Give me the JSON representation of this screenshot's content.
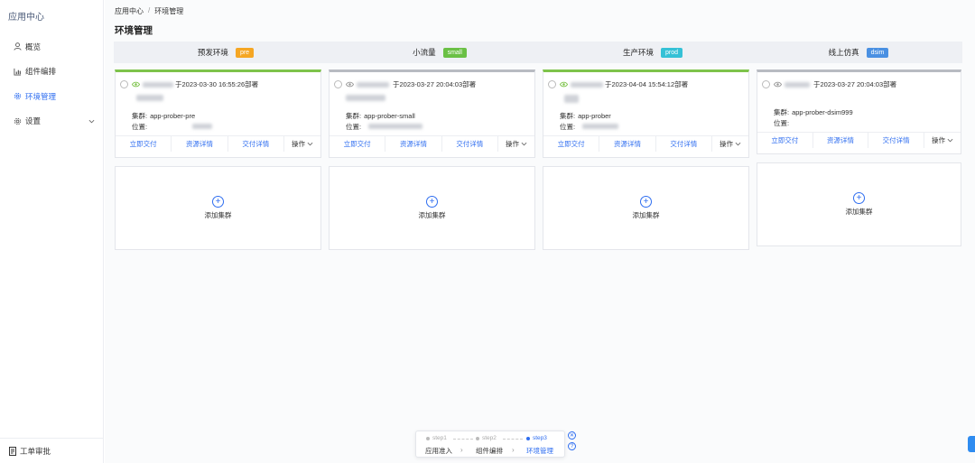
{
  "app": {
    "title": "应用中心"
  },
  "sidebar": {
    "items": [
      {
        "label": "概览",
        "icon": "user-icon"
      },
      {
        "label": "组件编排",
        "icon": "bar-chart-icon"
      },
      {
        "label": "环境管理",
        "icon": "gear-icon",
        "active": true
      },
      {
        "label": "设置",
        "icon": "gear-icon"
      }
    ],
    "footer": {
      "label": "工单审批",
      "icon": "document-icon"
    }
  },
  "breadcrumb": {
    "root": "应用中心",
    "sep": "/",
    "current": "环境管理"
  },
  "page": {
    "title": "环境管理"
  },
  "stages": [
    {
      "name": "预发环境",
      "badge": "pre",
      "badge_color": "#f5a623",
      "bar_color": "#7ec34b"
    },
    {
      "name": "小流量",
      "badge": "small",
      "badge_color": "#6ac045",
      "bar_color": "#b8bbc2"
    },
    {
      "name": "生产环境",
      "badge": "prod",
      "badge_color": "#35c1d6",
      "bar_color": "#7ec34b"
    },
    {
      "name": "线上仿真",
      "badge": "dsim",
      "badge_color": "#4a90e2",
      "bar_color": "#b8bbc2"
    }
  ],
  "cards": [
    {
      "deploy": "于2023-03-30 16:55:26部署",
      "cluster_label": "集群:",
      "cluster": "app-prober-pre",
      "location_label": "位置:"
    },
    {
      "deploy": "于2023-03-27 20:04:03部署",
      "cluster_label": "集群:",
      "cluster": "app-prober-small",
      "location_label": "位置:"
    },
    {
      "deploy": "于2023-04-04 15:54:12部署",
      "cluster_label": "集群:",
      "cluster": "app-prober",
      "location_label": "位置:"
    },
    {
      "deploy": "于2023-03-27 20:04:03部署",
      "cluster_label": "集群:",
      "cluster": "app-prober-dsim999",
      "location_label": "位置:"
    }
  ],
  "actions": {
    "deliver": "立即交付",
    "resource": "资源详情",
    "delivery": "交付详情",
    "more": "操作"
  },
  "add_cluster": "添加集群",
  "stepper": {
    "steps": [
      {
        "step": "step1",
        "label": "应用准入"
      },
      {
        "step": "step2",
        "label": "组件编排"
      },
      {
        "step": "step3",
        "label": "环境管理",
        "current": true
      }
    ]
  }
}
